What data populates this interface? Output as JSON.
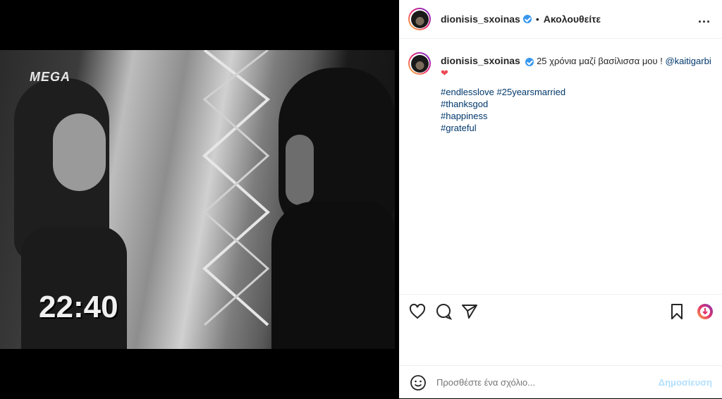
{
  "video": {
    "channel_logo": "MEGA",
    "timestamp": "22:40"
  },
  "header": {
    "username": "dionisis_sxoinas",
    "separator": "•",
    "follow_status": "Ακολουθείτε",
    "more": "..."
  },
  "caption": {
    "username": "dionisis_sxoinas",
    "text": "25 χρόνια μαζί βασίλισσα μου ! ",
    "mention": "@kaitigarbi",
    "heart": "❤",
    "hashtags": [
      "#endlesslove #25yearsmarried",
      "#thanksgod",
      "#happiness",
      "#grateful"
    ]
  },
  "actions": {
    "icons": [
      "heart-icon",
      "comment-icon",
      "share-icon",
      "bookmark-icon",
      "extension-icon"
    ]
  },
  "comment_bar": {
    "placeholder": "Προσθέστε ένα σχόλιο...",
    "publish_label": "Δημοσίευση"
  },
  "colors": {
    "link": "#00376b",
    "verified": "#3897f0",
    "heart": "#ed4956",
    "publish_disabled": "#b2dffc"
  }
}
